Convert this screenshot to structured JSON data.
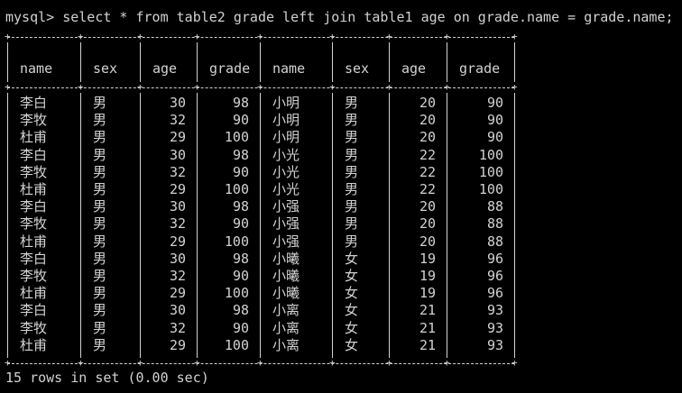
{
  "terminal": {
    "prompt": "mysql>",
    "command": "select * from table2 grade left join table1 age on grade.name = grade.name;",
    "footer": "15 rows in set (0.00 sec)"
  },
  "table": {
    "columns": [
      "name",
      "sex",
      "age",
      "grade",
      "name",
      "sex",
      "age",
      "grade"
    ],
    "rows": [
      [
        "李白",
        "男",
        "30",
        "98",
        "小明",
        "男",
        "20",
        "90"
      ],
      [
        "李牧",
        "男",
        "32",
        "90",
        "小明",
        "男",
        "20",
        "90"
      ],
      [
        "杜甫",
        "男",
        "29",
        "100",
        "小明",
        "男",
        "20",
        "90"
      ],
      [
        "李白",
        "男",
        "30",
        "98",
        "小光",
        "男",
        "22",
        "100"
      ],
      [
        "李牧",
        "男",
        "32",
        "90",
        "小光",
        "男",
        "22",
        "100"
      ],
      [
        "杜甫",
        "男",
        "29",
        "100",
        "小光",
        "男",
        "22",
        "100"
      ],
      [
        "李白",
        "男",
        "30",
        "98",
        "小强",
        "男",
        "20",
        "88"
      ],
      [
        "李牧",
        "男",
        "32",
        "90",
        "小强",
        "男",
        "20",
        "88"
      ],
      [
        "杜甫",
        "男",
        "29",
        "100",
        "小强",
        "男",
        "20",
        "88"
      ],
      [
        "李白",
        "男",
        "30",
        "98",
        "小曦",
        "女",
        "19",
        "96"
      ],
      [
        "李牧",
        "男",
        "32",
        "90",
        "小曦",
        "女",
        "19",
        "96"
      ],
      [
        "杜甫",
        "男",
        "29",
        "100",
        "小曦",
        "女",
        "19",
        "96"
      ],
      [
        "李白",
        "男",
        "30",
        "98",
        "小离",
        "女",
        "21",
        "93"
      ],
      [
        "李牧",
        "男",
        "32",
        "90",
        "小离",
        "女",
        "21",
        "93"
      ],
      [
        "杜甫",
        "男",
        "29",
        "100",
        "小离",
        "女",
        "21",
        "93"
      ]
    ]
  },
  "colors": {
    "background": "#000000",
    "text": "#d2d2d2"
  }
}
